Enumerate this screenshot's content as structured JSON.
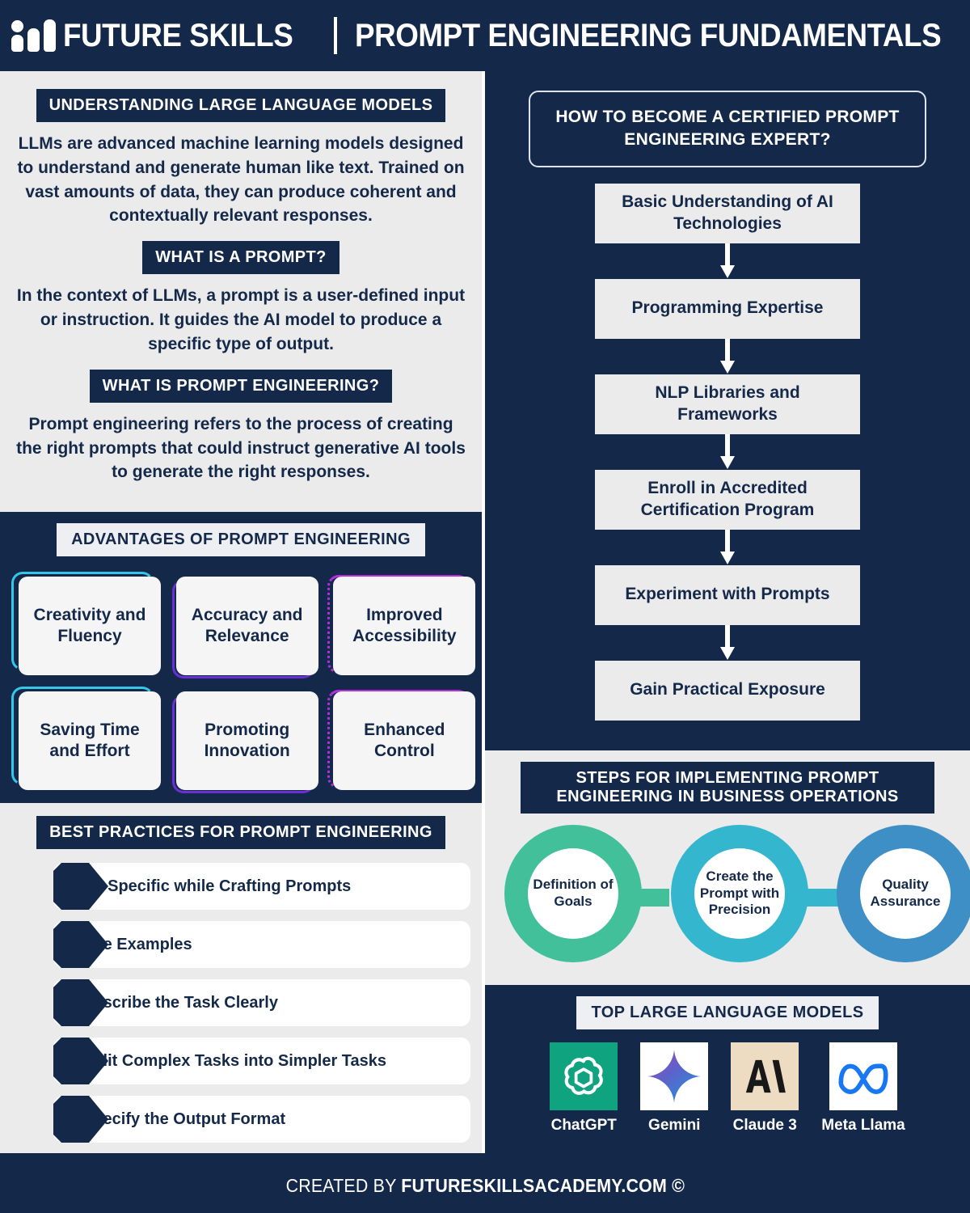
{
  "header": {
    "logo_icon": "bar-chart-logo-icon",
    "brand": "FUTURE SKILLS",
    "title": "PROMPT ENGINEERING FUNDAMENTALS"
  },
  "left": {
    "sections": [
      {
        "heading": "UNDERSTANDING LARGE LANGUAGE MODELS",
        "body": "LLMs are advanced machine learning models designed to understand and generate human like text. Trained on vast amounts of data, they can produce coherent and contextually relevant responses."
      },
      {
        "heading": "WHAT IS A PROMPT?",
        "body": "In the context of LLMs, a prompt is a user-defined input or instruction. It guides the AI model to produce a specific type of output."
      },
      {
        "heading": "WHAT IS PROMPT ENGINEERING?",
        "body": "Prompt engineering refers to the process of creating the right prompts that could instruct generative AI tools to generate the right responses."
      }
    ],
    "advantages": {
      "heading": "ADVANTAGES OF PROMPT ENGINEERING",
      "items": [
        {
          "label": "Creativity and Fluency",
          "accent": "#35c6e8"
        },
        {
          "label": "Accuracy and Relevance",
          "accent": "#6b2fd6"
        },
        {
          "label": "Improved Accessibility",
          "accent": "#b42ee0"
        },
        {
          "label": "Saving Time and Effort",
          "accent": "#35c6e8"
        },
        {
          "label": "Promoting Innovation",
          "accent": "#6b2fd6"
        },
        {
          "label": "Enhanced Control",
          "accent": "#b42ee0"
        }
      ]
    },
    "best_practices": {
      "heading": "BEST PRACTICES FOR PROMPT ENGINEERING",
      "items": [
        "Be Specific while Crafting Prompts",
        "Use Examples",
        "Describe the Task Clearly",
        "Split Complex Tasks into Simpler Tasks",
        "Specify the Output Format"
      ]
    }
  },
  "right": {
    "flowchart": {
      "title": "HOW TO BECOME A CERTIFIED PROMPT ENGINEERING EXPERT?",
      "steps": [
        "Basic Understanding of AI Technologies",
        "Programming Expertise",
        "NLP Libraries and Frameworks",
        "Enroll in Accredited Certification Program",
        "Experiment with Prompts",
        "Gain Practical Exposure"
      ]
    },
    "steps_business": {
      "heading": "STEPS FOR IMPLEMENTING PROMPT ENGINEERING IN BUSINESS OPERATIONS",
      "circles": [
        {
          "label": "Definition of Goals",
          "color": "#41c09a"
        },
        {
          "label": "Create the Prompt with Precision",
          "color": "#34b6cf"
        },
        {
          "label": "Quality Assurance",
          "color": "#3d8fc6"
        }
      ]
    },
    "llms": {
      "heading": "TOP LARGE LANGUAGE MODELS",
      "items": [
        {
          "name": "ChatGPT",
          "icon": "openai-logo-icon",
          "bg": "#10a37f"
        },
        {
          "name": "Gemini",
          "icon": "gemini-star-icon",
          "bg": "#ffffff"
        },
        {
          "name": "Claude 3",
          "icon": "anthropic-claude-logo-icon",
          "bg": "#eddcc2"
        },
        {
          "name": "Meta Llama",
          "icon": "meta-infinity-logo-icon",
          "bg": "#ffffff"
        }
      ]
    }
  },
  "footer": {
    "prefix": "CREATED BY ",
    "brand": "FUTURESKILLSACADEMY.COM ©"
  }
}
